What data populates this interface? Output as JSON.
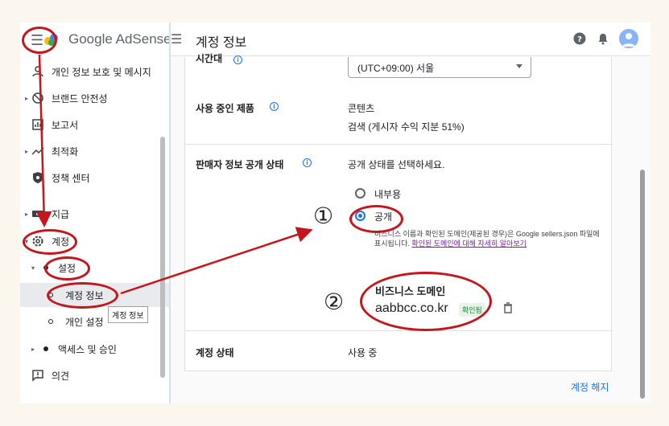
{
  "app": {
    "logo_text": "Google AdSense",
    "page_title": "계정 정보"
  },
  "sidebar": {
    "items": [
      {
        "label": "개인 정보 보호 및 메시지"
      },
      {
        "label": "브랜드 안전성"
      },
      {
        "label": "보고서"
      },
      {
        "label": "최적화"
      },
      {
        "label": "정책 센터"
      },
      {
        "label": "지급"
      },
      {
        "label": "계정"
      },
      {
        "label": "설정"
      },
      {
        "label": "계정 정보"
      },
      {
        "label": "개인 설정"
      },
      {
        "label": "액세스 및 승인"
      },
      {
        "label": "의견"
      }
    ],
    "tooltip": "계정 정보"
  },
  "content": {
    "timezone_label_partial": "시간대",
    "timezone_value": "(UTC+09:00) 서울",
    "products_label": "사용 중인 제품",
    "products_value_1": "콘텐츠",
    "products_value_2": "검색 (게시자 수익 지분 51%)",
    "seller_label": "판매자 정보 공개 상태",
    "seller_prompt": "공개 상태를 선택하세요.",
    "option_internal": "내부용",
    "option_public": "공개",
    "public_desc": "비즈니스 이름과 확인된 도메인(제공된 경우)은 Google sellers.json 파일에 표시됩니다.",
    "public_link": "확인된 도메인에 대해 자세히 알아보기",
    "business_domain_label": "비즈니스 도메인",
    "business_domain_value": "aabbcc.co.kr",
    "verified_badge": "확인됨",
    "account_status_label": "계정 상태",
    "account_status_value": "사용 중",
    "close_account": "계정 해지"
  },
  "annotations": {
    "num1": "①",
    "num2": "②",
    "color": "#c4161c"
  },
  "colors": {
    "accent": "#1a73e8",
    "annotation": "#c4161c",
    "verified": "#188038"
  }
}
